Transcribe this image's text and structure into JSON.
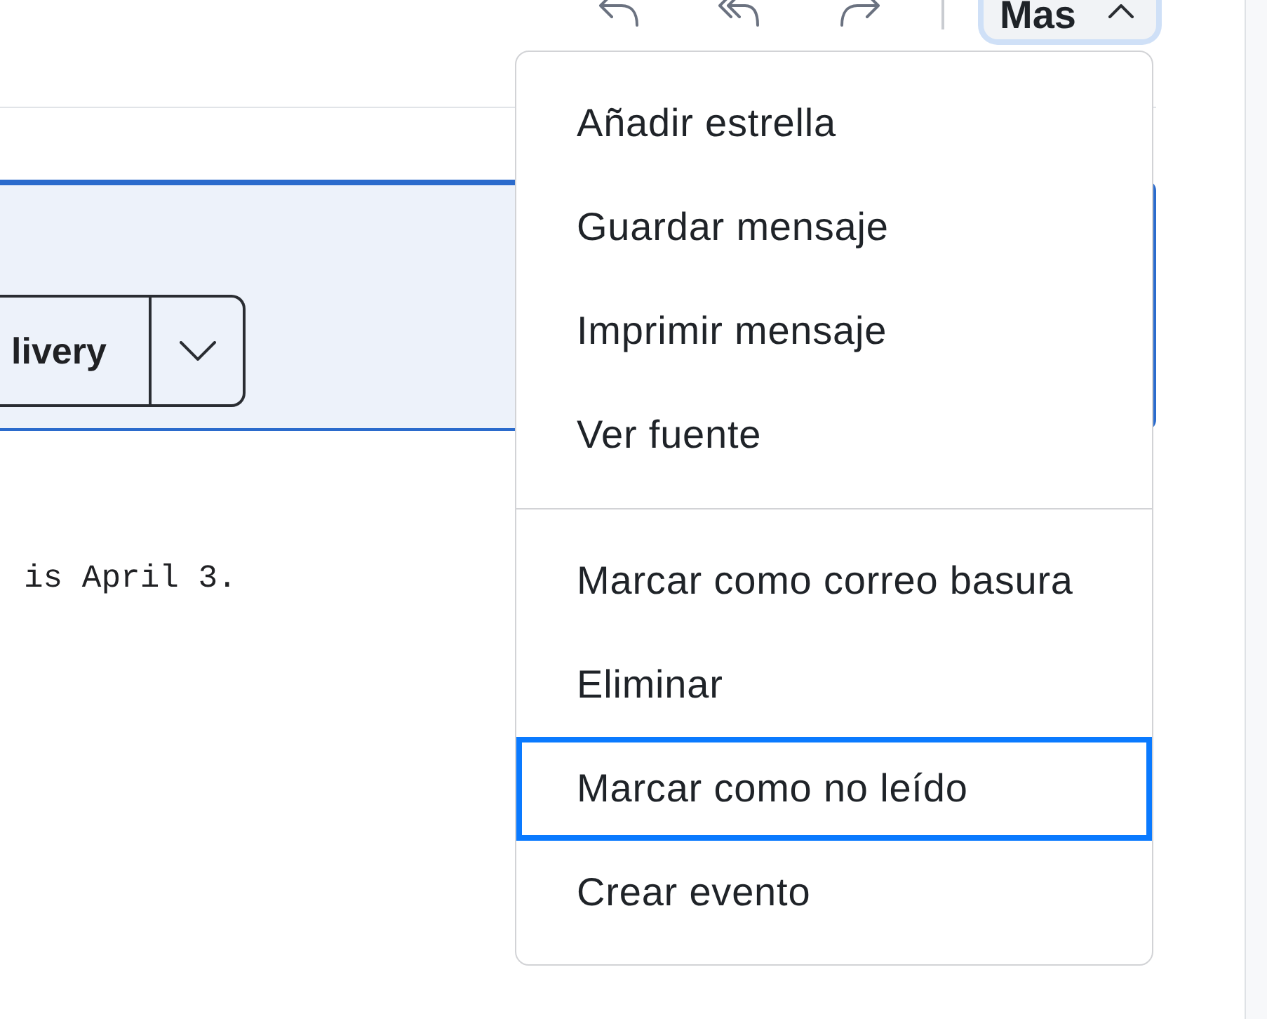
{
  "toolbar": {
    "more_button": {
      "label": "Mas",
      "expanded": true,
      "focused": true
    }
  },
  "banner": {
    "action_button": {
      "label": "livery"
    }
  },
  "body": {
    "text": "is April 3."
  },
  "menu": {
    "sections": [
      {
        "items": [
          {
            "label": "Añadir estrella",
            "focused": false
          },
          {
            "label": "Guardar mensaje",
            "focused": false
          },
          {
            "label": "Imprimir mensaje",
            "focused": false
          },
          {
            "label": "Ver fuente",
            "focused": false
          }
        ]
      },
      {
        "items": [
          {
            "label": "Marcar como correo basura",
            "focused": false
          },
          {
            "label": "Eliminar",
            "focused": false
          },
          {
            "label": "Marcar como no leído",
            "focused": true
          },
          {
            "label": "Crear evento",
            "focused": false
          }
        ]
      }
    ]
  }
}
